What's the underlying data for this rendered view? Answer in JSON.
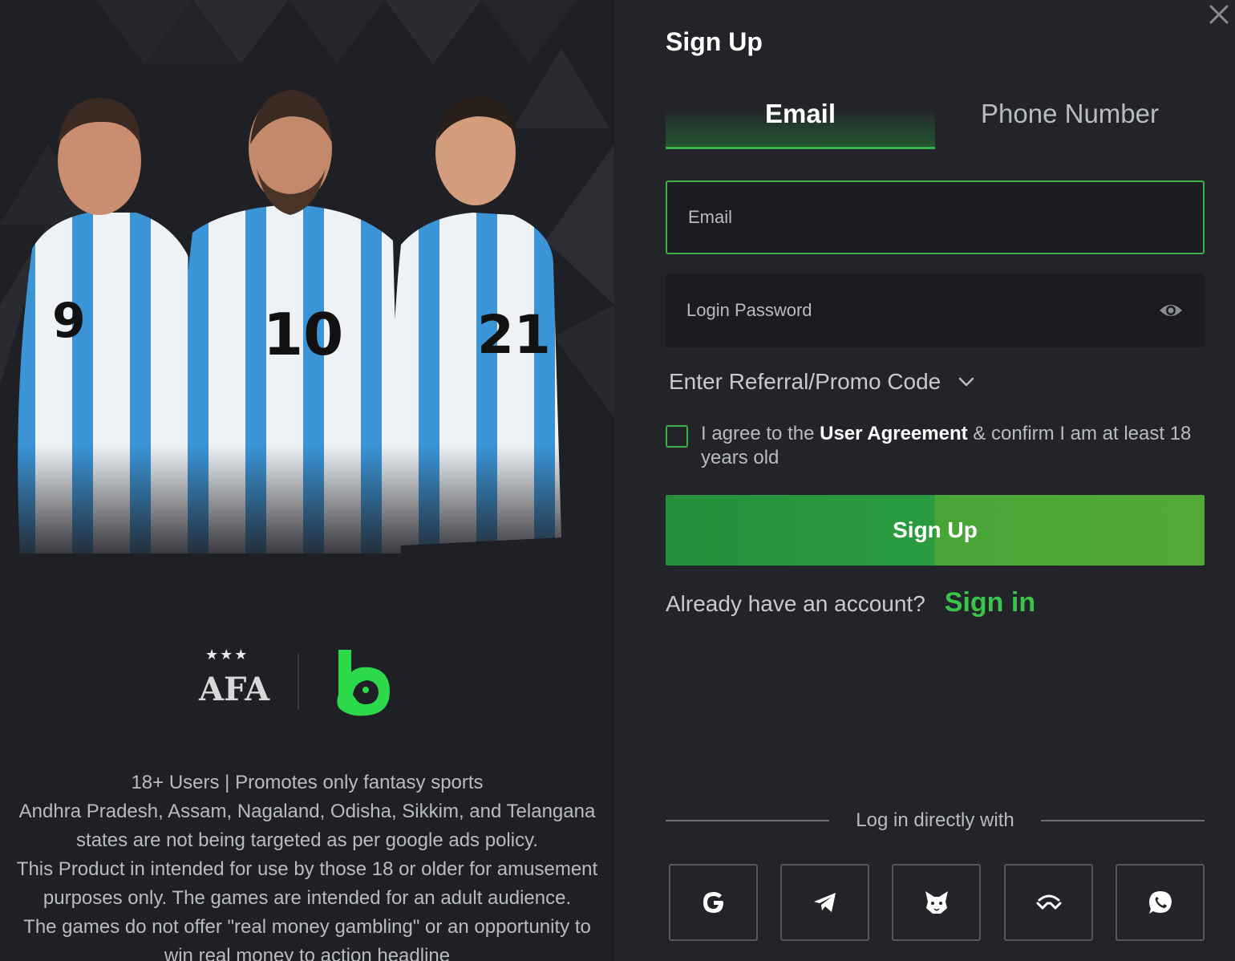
{
  "brand": {
    "afa_logo_text": "AFA",
    "afa_stars": "★★★",
    "bc_logo_letter": "b",
    "jersey_numbers": [
      "9",
      "10",
      "21"
    ]
  },
  "disclaimer": {
    "lines": [
      "18+ Users | Promotes only fantasy sports",
      "Andhra Pradesh, Assam, Nagaland, Odisha, Sikkim, and Telangana",
      "states are not being targeted as per google ads policy.",
      "This Product in intended for use by those 18 or older for amusement",
      "purposes only. The games are intended for an adult audience.",
      "The games do not offer \"real money gambling\" or an opportunity to",
      "win real money to action headline"
    ]
  },
  "form": {
    "title": "Sign Up",
    "tabs": [
      {
        "label": "Email",
        "active": true
      },
      {
        "label": "Phone Number",
        "active": false
      }
    ],
    "email_placeholder": "Email",
    "password_placeholder": "Login Password",
    "promo_label": "Enter Referral/Promo Code",
    "agree_prefix": "I agree to the",
    "agree_link": "User Agreement",
    "agree_suffix": "& confirm I am at least 18 years old",
    "signup_button": "Sign Up",
    "have_account": "Already have an account?",
    "signin_link": "Sign in",
    "direct_login": "Log in directly with",
    "social": [
      "google-icon",
      "telegram-icon",
      "metamask-icon",
      "walletconnect-icon",
      "whatsapp-icon"
    ]
  },
  "colors": {
    "accent_green": "#3bb14a",
    "bg_dark": "#232429",
    "panel_left": "#1f2025"
  }
}
